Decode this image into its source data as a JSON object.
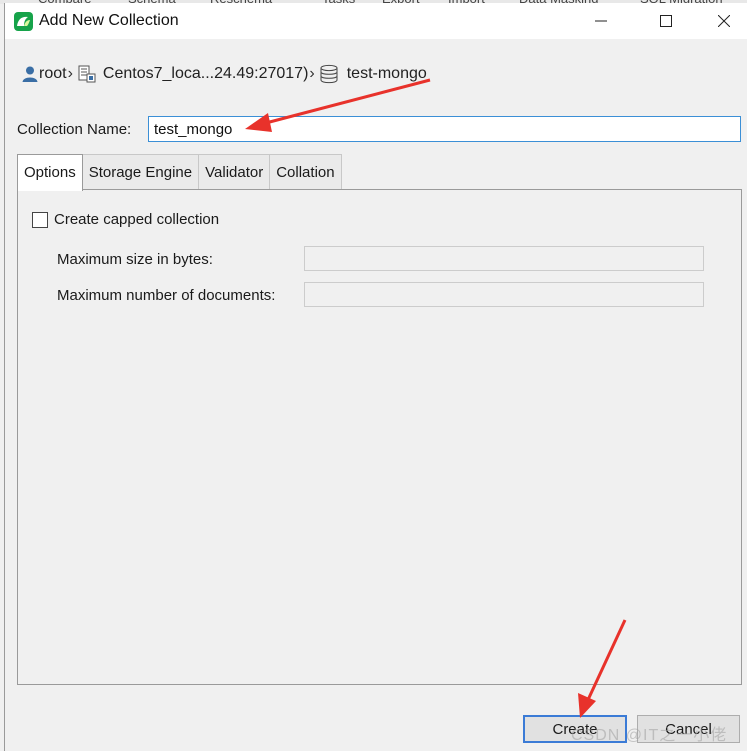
{
  "background_menu": [
    "Compare",
    "Schema",
    "Reschema",
    "Tasks",
    "Export",
    "Import",
    "Data Masking",
    "SQL Migration"
  ],
  "window": {
    "title": "Add New Collection"
  },
  "breadcrumb": {
    "items": [
      {
        "label": "root",
        "icon": "user-icon"
      },
      {
        "label": "Centos7_loca...24.49:27017)",
        "icon": "server-icon"
      },
      {
        "label": "test-mongo",
        "icon": "database-icon"
      }
    ]
  },
  "form": {
    "collection_name_label": "Collection Name:",
    "collection_name_value": "test_mongo"
  },
  "tabs": [
    "Options",
    "Storage Engine",
    "Validator",
    "Collation"
  ],
  "options": {
    "capped_label": "Create capped collection",
    "capped_checked": false,
    "max_size_label": "Maximum size in bytes:",
    "max_size_value": "",
    "max_docs_label": "Maximum number of documents:",
    "max_docs_value": ""
  },
  "buttons": {
    "create": "Create",
    "cancel": "Cancel"
  },
  "watermark": "CSDN @IT之一小佬",
  "colors": {
    "accent": "#3b8fd6",
    "annotation_arrow": "#e8322b",
    "app_icon": "#16a34a"
  }
}
